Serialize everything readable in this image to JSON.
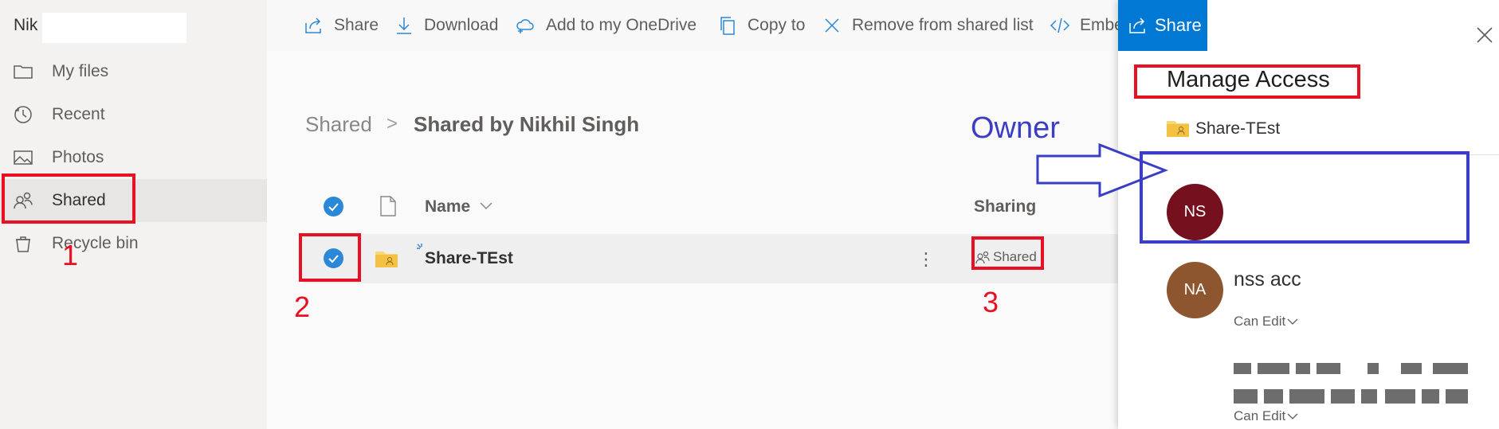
{
  "nav": {
    "user_name": "Nik",
    "items": [
      {
        "label": "My files",
        "icon": "folder-icon"
      },
      {
        "label": "Recent",
        "icon": "clock-icon"
      },
      {
        "label": "Photos",
        "icon": "image-icon"
      },
      {
        "label": "Shared",
        "icon": "people-icon"
      },
      {
        "label": "Recycle bin",
        "icon": "recycle-bin-icon"
      }
    ],
    "selected": "Shared"
  },
  "toolbar": {
    "share": "Share",
    "download": "Download",
    "add_onedrive": "Add to my OneDrive",
    "copy_to": "Copy to",
    "remove_shared": "Remove from shared list",
    "embed": "Embe"
  },
  "breadcrumb": {
    "root": "Shared",
    "separator": ">",
    "current": "Shared by Nikhil Singh"
  },
  "list": {
    "columns": {
      "name": "Name",
      "sharing": "Sharing"
    },
    "rows": [
      {
        "name": "Share-TEst",
        "sharing": "Shared",
        "more": "⋮"
      }
    ]
  },
  "annotations": {
    "n1": "1",
    "n2": "2",
    "n3": "3",
    "owner": "Owner"
  },
  "panel": {
    "tab_label": "Share",
    "title": "Manage Access",
    "item_name": "Share-TEst",
    "people": [
      {
        "initials": "NS",
        "name": "",
        "color": "#75111e",
        "permission": ""
      },
      {
        "initials": "NA",
        "name": "nss acc",
        "color": "#8e562e",
        "permission": "Can Edit"
      },
      {
        "initials": "",
        "name": "",
        "color": "",
        "permission": "Can Edit"
      }
    ]
  },
  "colors": {
    "accent": "#0078d4",
    "annotation_red": "#e81123",
    "annotation_blue": "#3a3ec4",
    "check_blue": "#2b88d8"
  }
}
